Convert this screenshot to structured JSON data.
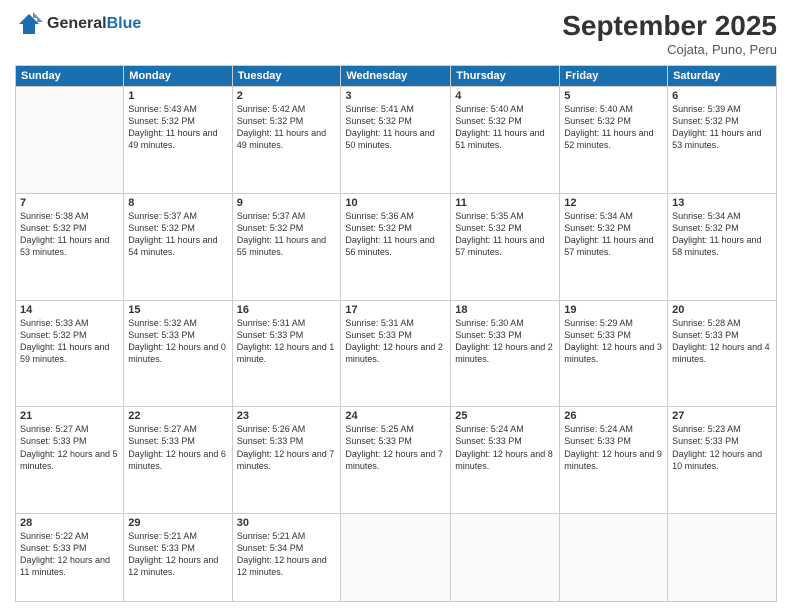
{
  "header": {
    "logo_general": "General",
    "logo_blue": "Blue",
    "month": "September 2025",
    "location": "Cojata, Puno, Peru"
  },
  "weekdays": [
    "Sunday",
    "Monday",
    "Tuesday",
    "Wednesday",
    "Thursday",
    "Friday",
    "Saturday"
  ],
  "weeks": [
    [
      {
        "day": "",
        "text": ""
      },
      {
        "day": "1",
        "text": "Sunrise: 5:43 AM\nSunset: 5:32 PM\nDaylight: 11 hours\nand 49 minutes."
      },
      {
        "day": "2",
        "text": "Sunrise: 5:42 AM\nSunset: 5:32 PM\nDaylight: 11 hours\nand 49 minutes."
      },
      {
        "day": "3",
        "text": "Sunrise: 5:41 AM\nSunset: 5:32 PM\nDaylight: 11 hours\nand 50 minutes."
      },
      {
        "day": "4",
        "text": "Sunrise: 5:40 AM\nSunset: 5:32 PM\nDaylight: 11 hours\nand 51 minutes."
      },
      {
        "day": "5",
        "text": "Sunrise: 5:40 AM\nSunset: 5:32 PM\nDaylight: 11 hours\nand 52 minutes."
      },
      {
        "day": "6",
        "text": "Sunrise: 5:39 AM\nSunset: 5:32 PM\nDaylight: 11 hours\nand 53 minutes."
      }
    ],
    [
      {
        "day": "7",
        "text": "Sunrise: 5:38 AM\nSunset: 5:32 PM\nDaylight: 11 hours\nand 53 minutes."
      },
      {
        "day": "8",
        "text": "Sunrise: 5:37 AM\nSunset: 5:32 PM\nDaylight: 11 hours\nand 54 minutes."
      },
      {
        "day": "9",
        "text": "Sunrise: 5:37 AM\nSunset: 5:32 PM\nDaylight: 11 hours\nand 55 minutes."
      },
      {
        "day": "10",
        "text": "Sunrise: 5:36 AM\nSunset: 5:32 PM\nDaylight: 11 hours\nand 56 minutes."
      },
      {
        "day": "11",
        "text": "Sunrise: 5:35 AM\nSunset: 5:32 PM\nDaylight: 11 hours\nand 57 minutes."
      },
      {
        "day": "12",
        "text": "Sunrise: 5:34 AM\nSunset: 5:32 PM\nDaylight: 11 hours\nand 57 minutes."
      },
      {
        "day": "13",
        "text": "Sunrise: 5:34 AM\nSunset: 5:32 PM\nDaylight: 11 hours\nand 58 minutes."
      }
    ],
    [
      {
        "day": "14",
        "text": "Sunrise: 5:33 AM\nSunset: 5:32 PM\nDaylight: 11 hours\nand 59 minutes."
      },
      {
        "day": "15",
        "text": "Sunrise: 5:32 AM\nSunset: 5:33 PM\nDaylight: 12 hours\nand 0 minutes."
      },
      {
        "day": "16",
        "text": "Sunrise: 5:31 AM\nSunset: 5:33 PM\nDaylight: 12 hours\nand 1 minute."
      },
      {
        "day": "17",
        "text": "Sunrise: 5:31 AM\nSunset: 5:33 PM\nDaylight: 12 hours\nand 2 minutes."
      },
      {
        "day": "18",
        "text": "Sunrise: 5:30 AM\nSunset: 5:33 PM\nDaylight: 12 hours\nand 2 minutes."
      },
      {
        "day": "19",
        "text": "Sunrise: 5:29 AM\nSunset: 5:33 PM\nDaylight: 12 hours\nand 3 minutes."
      },
      {
        "day": "20",
        "text": "Sunrise: 5:28 AM\nSunset: 5:33 PM\nDaylight: 12 hours\nand 4 minutes."
      }
    ],
    [
      {
        "day": "21",
        "text": "Sunrise: 5:27 AM\nSunset: 5:33 PM\nDaylight: 12 hours\nand 5 minutes."
      },
      {
        "day": "22",
        "text": "Sunrise: 5:27 AM\nSunset: 5:33 PM\nDaylight: 12 hours\nand 6 minutes."
      },
      {
        "day": "23",
        "text": "Sunrise: 5:26 AM\nSunset: 5:33 PM\nDaylight: 12 hours\nand 7 minutes."
      },
      {
        "day": "24",
        "text": "Sunrise: 5:25 AM\nSunset: 5:33 PM\nDaylight: 12 hours\nand 7 minutes."
      },
      {
        "day": "25",
        "text": "Sunrise: 5:24 AM\nSunset: 5:33 PM\nDaylight: 12 hours\nand 8 minutes."
      },
      {
        "day": "26",
        "text": "Sunrise: 5:24 AM\nSunset: 5:33 PM\nDaylight: 12 hours\nand 9 minutes."
      },
      {
        "day": "27",
        "text": "Sunrise: 5:23 AM\nSunset: 5:33 PM\nDaylight: 12 hours\nand 10 minutes."
      }
    ],
    [
      {
        "day": "28",
        "text": "Sunrise: 5:22 AM\nSunset: 5:33 PM\nDaylight: 12 hours\nand 11 minutes."
      },
      {
        "day": "29",
        "text": "Sunrise: 5:21 AM\nSunset: 5:33 PM\nDaylight: 12 hours\nand 12 minutes."
      },
      {
        "day": "30",
        "text": "Sunrise: 5:21 AM\nSunset: 5:34 PM\nDaylight: 12 hours\nand 12 minutes."
      },
      {
        "day": "",
        "text": ""
      },
      {
        "day": "",
        "text": ""
      },
      {
        "day": "",
        "text": ""
      },
      {
        "day": "",
        "text": ""
      }
    ]
  ]
}
